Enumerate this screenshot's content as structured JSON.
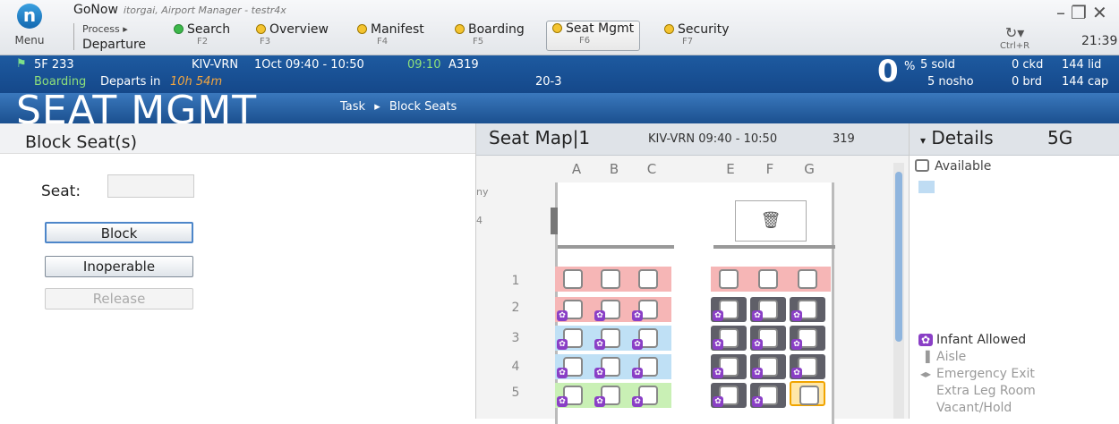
{
  "app": {
    "name": "GoNow",
    "context": "itorgai, Airport Manager - testr4x",
    "menu_label": "Menu",
    "process_label": "Process ▸",
    "process_name": "Departure",
    "clock": "21:39",
    "refresh_key": "Ctrl+R"
  },
  "nav": [
    {
      "label": "Search",
      "key": "F2",
      "status": "green"
    },
    {
      "label": "Overview",
      "key": "F3",
      "status": "orange"
    },
    {
      "label": "Manifest",
      "key": "F4",
      "status": "orange"
    },
    {
      "label": "Boarding",
      "key": "F5",
      "status": "orange"
    },
    {
      "label": "Seat Mgmt",
      "key": "F6",
      "status": "orange",
      "active": true
    },
    {
      "label": "Security",
      "key": "F7",
      "status": "orange"
    }
  ],
  "flight": {
    "number": "5F 233",
    "route": "KIV-VRN",
    "date_times": "1Oct 09:40 - 10:50",
    "boarding_time": "09:10",
    "aircraft": "A319",
    "status": "Boarding",
    "departs_label": "Departs in",
    "departs_in": "10h 54m",
    "gate": "20-3",
    "load_pct": "0",
    "pct_sign": "%",
    "sold": "5 sold",
    "ckd": "0 ckd",
    "lid": "144 lid",
    "nosho": "5 nosho",
    "brd": "0 brd",
    "cap": "144 cap"
  },
  "banner": {
    "title": "SEAT MGMT",
    "crumb_task": "Task",
    "crumb_sep": "▸",
    "crumb_page": "Block Seats"
  },
  "block_panel": {
    "title": "Block Seat(s)",
    "seat_label": "Seat:",
    "seat_value": "",
    "buttons": {
      "block": "Block",
      "inoperable": "Inoperable",
      "release": "Release"
    }
  },
  "seat_map": {
    "title": "Seat Map|1",
    "route_time": "KIV-VRN 09:40 - 10:50",
    "aircraft": "319",
    "columns": [
      "A",
      "B",
      "C",
      "E",
      "F",
      "G"
    ],
    "edge_text_1": "ny",
    "edge_text_2": "4",
    "rows": [
      "1",
      "2",
      "3",
      "4",
      "5"
    ],
    "selected_seat": "5G"
  },
  "details": {
    "title": "Details",
    "seat": "5G",
    "status": "Available",
    "legend": [
      "Infant Allowed",
      "Aisle",
      "Emergency Exit",
      "Extra Leg Room",
      "Vacant/Hold"
    ]
  },
  "colors": {
    "brand_blue": "#1d5aa0",
    "infant_purple": "#8a3fc6",
    "selected_orange": "#f0a400",
    "row_red": "#f6b6b6",
    "row_blue": "#bfe0f5",
    "row_green": "#c9f0b5"
  }
}
